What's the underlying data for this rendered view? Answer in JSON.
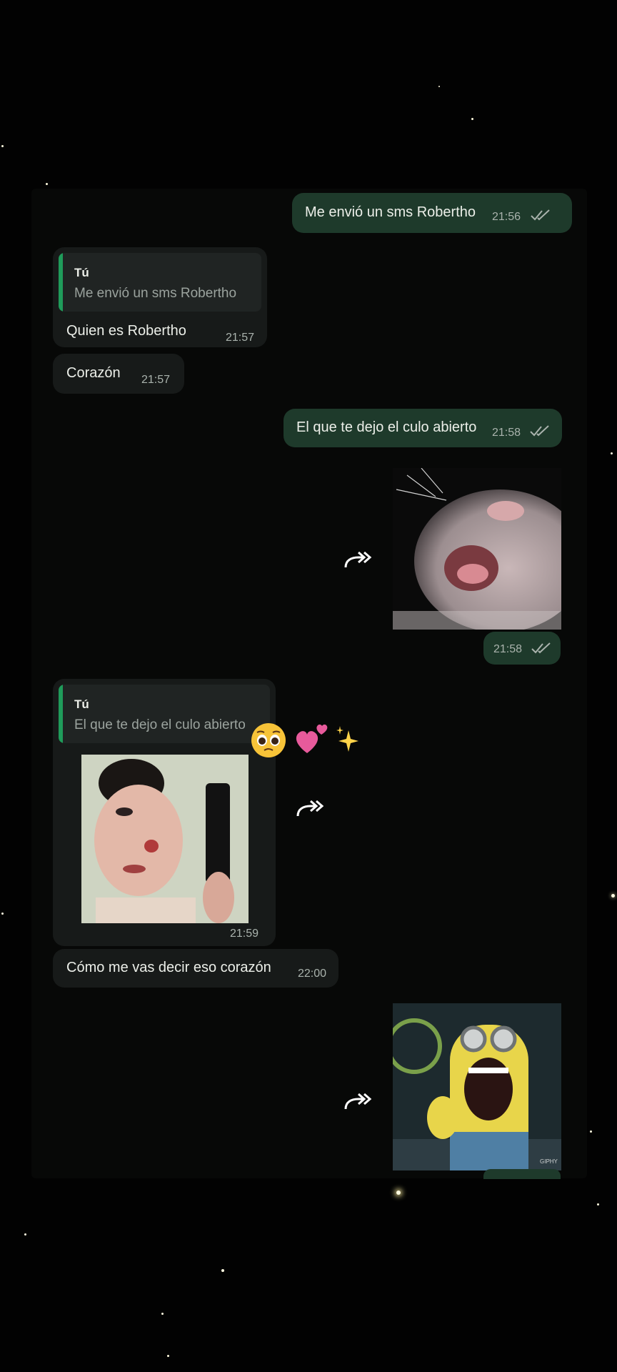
{
  "messages": [
    {
      "direction": "out",
      "text": "Me envió un sms Robertho",
      "time": "21:56",
      "status": "read"
    },
    {
      "direction": "in",
      "reply_author": "Tú",
      "reply_text": "Me envió un sms Robertho",
      "text": "Quien es Robertho",
      "time": "21:57"
    },
    {
      "direction": "in",
      "text": "Corazón",
      "time": "21:57"
    },
    {
      "direction": "out",
      "text": "El que te dejo el culo abierto",
      "time": "21:58",
      "status": "read"
    },
    {
      "direction": "out",
      "media": "screaming-rat-sticker",
      "time": "21:58",
      "status": "read"
    },
    {
      "direction": "in",
      "reply_author": "Tú",
      "reply_text": "El que te dejo el culo abierto",
      "media": "clown-boy-phone-image",
      "time": "21:59"
    },
    {
      "direction": "in",
      "text": "Cómo me vas decir eso corazón",
      "time": "22:00"
    },
    {
      "direction": "out",
      "media": "screaming-minion-gif"
    }
  ],
  "decorations": [
    "pleading-face-emoji",
    "two-hearts-emoji",
    "sparkles-emoji"
  ],
  "gif_badge": "GIPHY",
  "colors": {
    "outgoing_bubble": "#1e3a2b",
    "incoming_bubble": "#171a19",
    "reply_bar": "#1f9b5a",
    "background": "#020202"
  }
}
